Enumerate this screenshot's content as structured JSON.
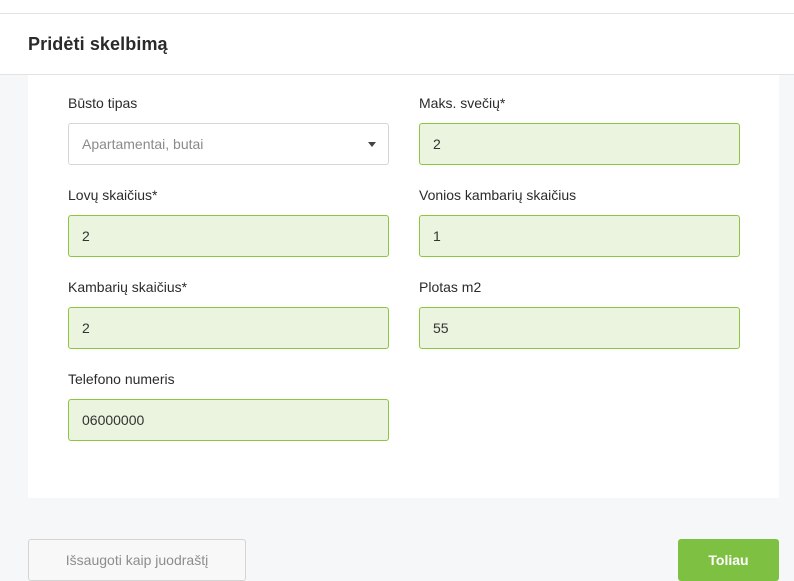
{
  "header": {
    "title": "Pridėti skelbimą"
  },
  "form": {
    "busto_tipas": {
      "label": "Būsto tipas",
      "selected": "Apartamentai, butai"
    },
    "maks_sveciu": {
      "label": "Maks. svečių*",
      "value": "2"
    },
    "lovu_skaicius": {
      "label": "Lovų skaičius*",
      "value": "2"
    },
    "vonios_kambariu": {
      "label": "Vonios kambarių skaičius",
      "value": "1"
    },
    "kambariu_skaicius": {
      "label": "Kambarių skaičius*",
      "value": "2"
    },
    "plotas": {
      "label": "Plotas m2",
      "value": "55"
    },
    "telefonas": {
      "label": "Telefono numeris",
      "value": "06000000"
    }
  },
  "footer": {
    "draft_label": "Išsaugoti kaip juodraštį",
    "next_label": "Toliau"
  },
  "colors": {
    "accent": "#7ec142",
    "field_border": "#8cc63f",
    "field_bg": "#eaf4df"
  },
  "icons": {
    "select_caret": "chevron-down-icon"
  }
}
